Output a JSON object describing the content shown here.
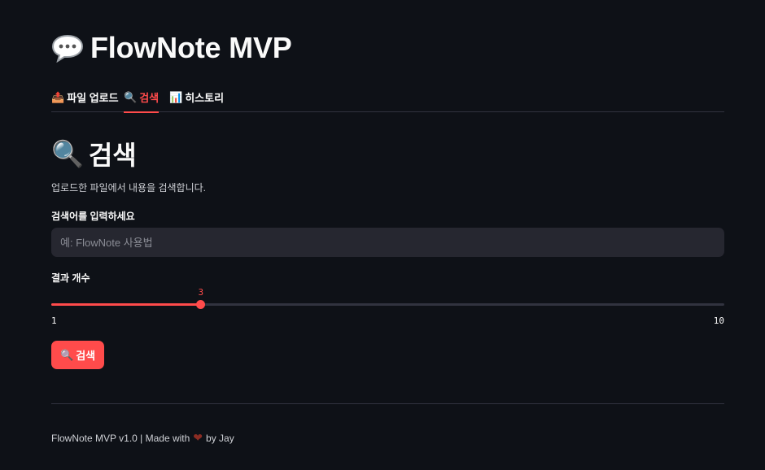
{
  "app": {
    "title": "FlowNote MVP",
    "title_icon": "speech-bubble-icon"
  },
  "tabs": [
    {
      "icon": "📤",
      "icon_name": "outbox-tray-icon",
      "label": "파일 업로드",
      "active": false
    },
    {
      "icon": "🔍",
      "icon_name": "magnifier-icon",
      "label": "검색",
      "active": true
    },
    {
      "icon": "📊",
      "icon_name": "bar-chart-icon",
      "label": "히스토리",
      "active": false
    }
  ],
  "search_page": {
    "icon": "🔍",
    "title": "검색",
    "description": "업로드한 파일에서 내용을 검색합니다.",
    "query_label": "검색어를 입력하세요",
    "query_placeholder": "예: FlowNote 사용법",
    "query_value": "",
    "count_label": "결과 개수",
    "count_value": "3",
    "count_min": "1",
    "count_max": "10",
    "button_icon": "🔍",
    "button_label": "검색"
  },
  "footer": {
    "text_before": "FlowNote MVP v1.0 | Made with",
    "heart_icon": "❤",
    "text_after": "by Jay"
  },
  "colors": {
    "background": "#0e1117",
    "accent": "#ff4b4b",
    "input_bg": "#262730",
    "border": "#31333f"
  }
}
